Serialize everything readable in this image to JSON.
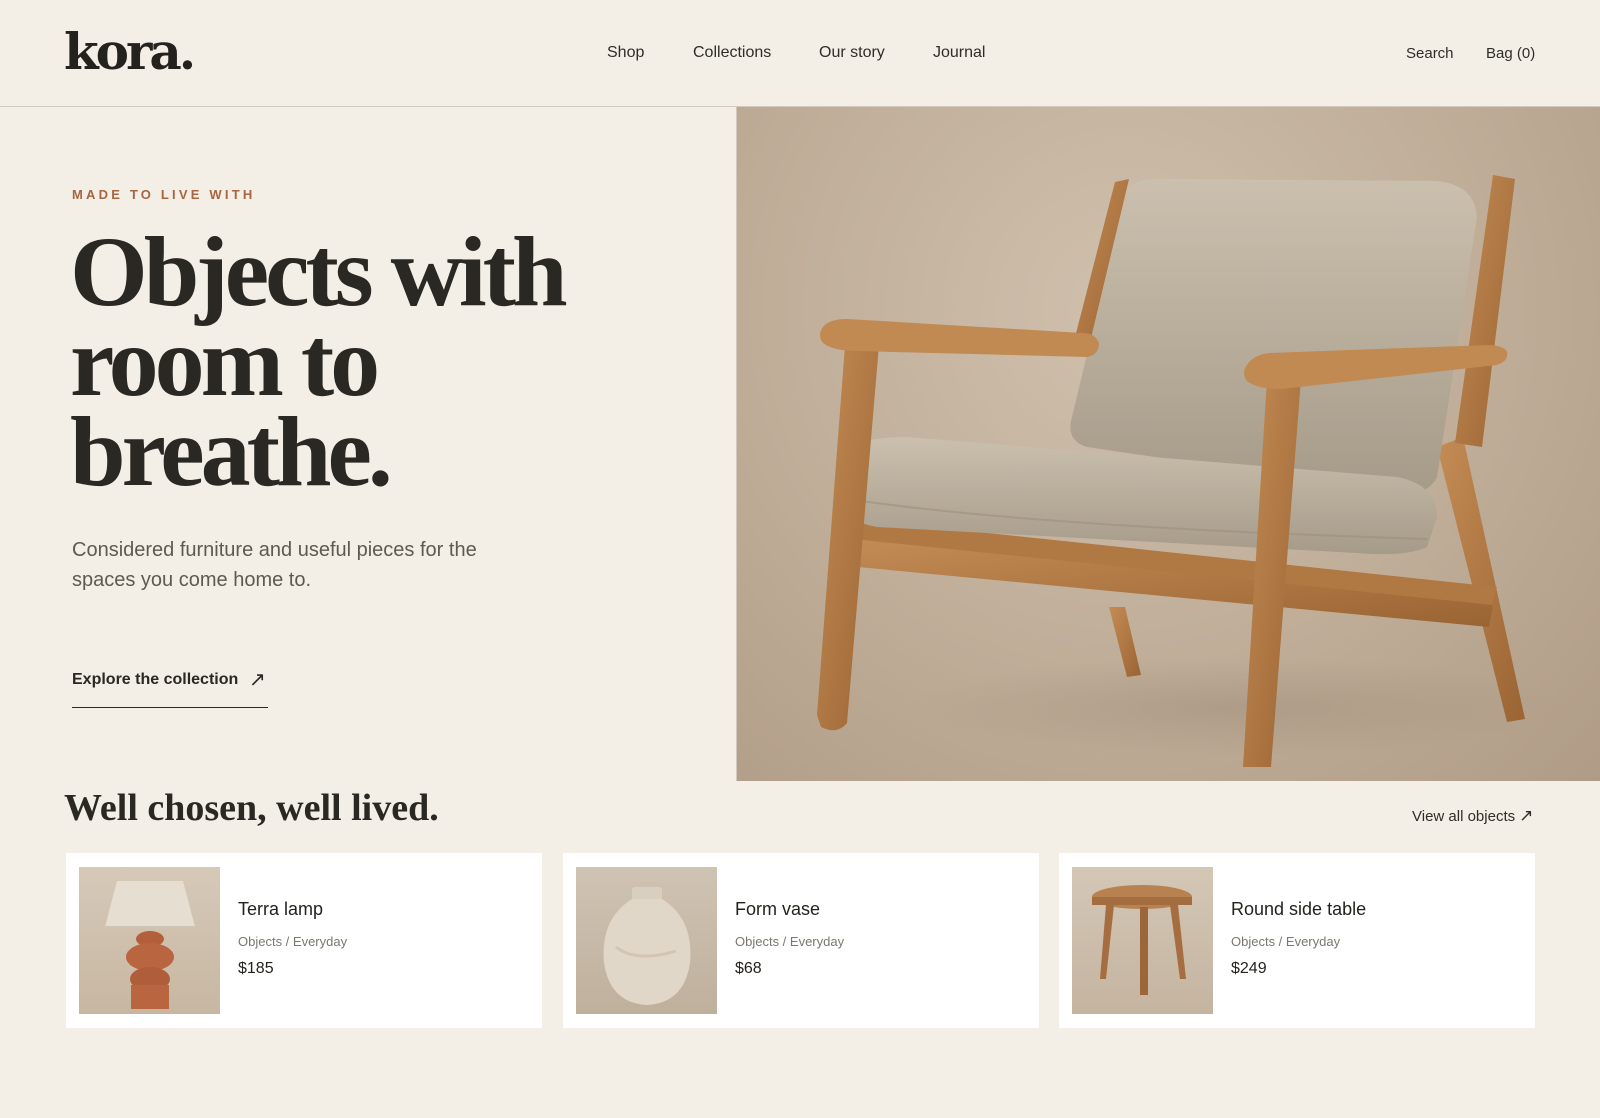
{
  "brand": {
    "logo": "kora."
  },
  "nav": {
    "items": [
      {
        "label": "Shop"
      },
      {
        "label": "Collections"
      },
      {
        "label": "Our story"
      },
      {
        "label": "Journal"
      }
    ]
  },
  "header_actions": {
    "search": "Search",
    "bag": "Bag (0)"
  },
  "hero": {
    "eyebrow": "MADE TO LIVE WITH",
    "headline_lines": [
      "Objects with",
      "room to",
      "breathe."
    ],
    "subtext_lines": [
      "Considered furniture and useful pieces for the",
      "spaces you come home to."
    ],
    "cta_label": "Explore the collection",
    "cta_icon": "arrow-up-right-icon",
    "image_subject": "wooden lounge chair with beige boucle cushions"
  },
  "featured": {
    "title": "Well chosen, well lived.",
    "view_all": "View all objects",
    "products": [
      {
        "name": "Terra lamp",
        "category": "Objects / Everyday",
        "price": "$185",
        "image_subject": "terracotta table lamp"
      },
      {
        "name": "Form vase",
        "category": "Objects / Everyday",
        "price": "$68",
        "image_subject": "stoneware vase"
      },
      {
        "name": "Round side table",
        "category": "Objects / Everyday",
        "price": "$249",
        "image_subject": "round wooden side table"
      }
    ]
  },
  "colors": {
    "background": "#f3eee6",
    "text": "#2a2823",
    "accent": "#a86540",
    "card": "#ffffff"
  }
}
